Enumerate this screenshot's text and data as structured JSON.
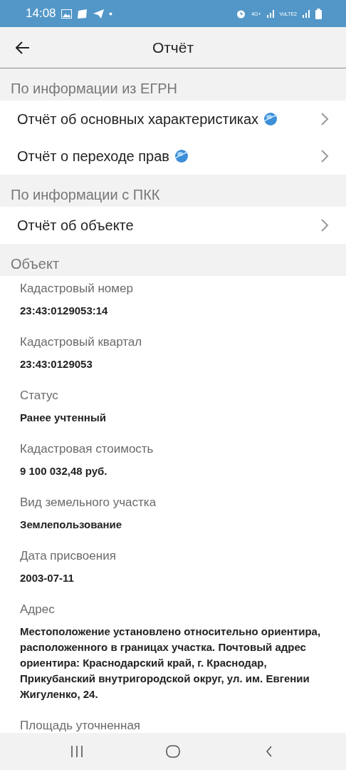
{
  "status_bar": {
    "time": "14:08",
    "network_1": "4G+",
    "network_2": "VoLTE2"
  },
  "app_bar": {
    "title": "Отчёт"
  },
  "report_sections": [
    {
      "title": "По информации из ЕГРН",
      "items": [
        {
          "label": "Отчёт об основных характеристиках",
          "globe": true
        },
        {
          "label": "Отчёт о переходе прав",
          "globe": true
        }
      ]
    },
    {
      "title": "По информации с ПКК",
      "items": [
        {
          "label": "Отчёт об объекте",
          "globe": false
        }
      ]
    }
  ],
  "object": {
    "title": "Объект",
    "fields": [
      {
        "label": "Кадастровый номер",
        "value": "23:43:0129053:14"
      },
      {
        "label": "Кадастровый квартал",
        "value": "23:43:0129053"
      },
      {
        "label": "Статус",
        "value": "Ранее учтенный"
      },
      {
        "label": "Кадастровая стоимость",
        "value": "9 100 032,48 руб."
      },
      {
        "label": "Вид земельного участка",
        "value": "Землепользование"
      },
      {
        "label": "Дата присвоения",
        "value": "2003-07-11"
      },
      {
        "label": "Адрес",
        "value": "Местоположение установлено относительно ориентира, расположенного в границах участка. Почтовый адрес ориентира: Краснодарский край, г. Краснодар, Прикубанский внутригородской округ, ул. им. Евгении Жигуленко, 24."
      },
      {
        "label": "Площадь уточненная"
      }
    ]
  }
}
